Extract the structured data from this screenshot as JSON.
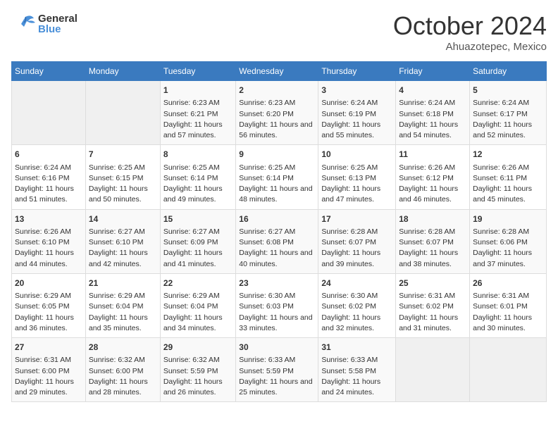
{
  "header": {
    "logo_line1": "General",
    "logo_line2": "Blue",
    "month": "October 2024",
    "location": "Ahuazotepec, Mexico"
  },
  "weekdays": [
    "Sunday",
    "Monday",
    "Tuesday",
    "Wednesday",
    "Thursday",
    "Friday",
    "Saturday"
  ],
  "weeks": [
    [
      {
        "day": "",
        "content": ""
      },
      {
        "day": "",
        "content": ""
      },
      {
        "day": "1",
        "content": "Sunrise: 6:23 AM\nSunset: 6:21 PM\nDaylight: 11 hours and 57 minutes."
      },
      {
        "day": "2",
        "content": "Sunrise: 6:23 AM\nSunset: 6:20 PM\nDaylight: 11 hours and 56 minutes."
      },
      {
        "day": "3",
        "content": "Sunrise: 6:24 AM\nSunset: 6:19 PM\nDaylight: 11 hours and 55 minutes."
      },
      {
        "day": "4",
        "content": "Sunrise: 6:24 AM\nSunset: 6:18 PM\nDaylight: 11 hours and 54 minutes."
      },
      {
        "day": "5",
        "content": "Sunrise: 6:24 AM\nSunset: 6:17 PM\nDaylight: 11 hours and 52 minutes."
      }
    ],
    [
      {
        "day": "6",
        "content": "Sunrise: 6:24 AM\nSunset: 6:16 PM\nDaylight: 11 hours and 51 minutes."
      },
      {
        "day": "7",
        "content": "Sunrise: 6:25 AM\nSunset: 6:15 PM\nDaylight: 11 hours and 50 minutes."
      },
      {
        "day": "8",
        "content": "Sunrise: 6:25 AM\nSunset: 6:14 PM\nDaylight: 11 hours and 49 minutes."
      },
      {
        "day": "9",
        "content": "Sunrise: 6:25 AM\nSunset: 6:14 PM\nDaylight: 11 hours and 48 minutes."
      },
      {
        "day": "10",
        "content": "Sunrise: 6:25 AM\nSunset: 6:13 PM\nDaylight: 11 hours and 47 minutes."
      },
      {
        "day": "11",
        "content": "Sunrise: 6:26 AM\nSunset: 6:12 PM\nDaylight: 11 hours and 46 minutes."
      },
      {
        "day": "12",
        "content": "Sunrise: 6:26 AM\nSunset: 6:11 PM\nDaylight: 11 hours and 45 minutes."
      }
    ],
    [
      {
        "day": "13",
        "content": "Sunrise: 6:26 AM\nSunset: 6:10 PM\nDaylight: 11 hours and 44 minutes."
      },
      {
        "day": "14",
        "content": "Sunrise: 6:27 AM\nSunset: 6:10 PM\nDaylight: 11 hours and 42 minutes."
      },
      {
        "day": "15",
        "content": "Sunrise: 6:27 AM\nSunset: 6:09 PM\nDaylight: 11 hours and 41 minutes."
      },
      {
        "day": "16",
        "content": "Sunrise: 6:27 AM\nSunset: 6:08 PM\nDaylight: 11 hours and 40 minutes."
      },
      {
        "day": "17",
        "content": "Sunrise: 6:28 AM\nSunset: 6:07 PM\nDaylight: 11 hours and 39 minutes."
      },
      {
        "day": "18",
        "content": "Sunrise: 6:28 AM\nSunset: 6:07 PM\nDaylight: 11 hours and 38 minutes."
      },
      {
        "day": "19",
        "content": "Sunrise: 6:28 AM\nSunset: 6:06 PM\nDaylight: 11 hours and 37 minutes."
      }
    ],
    [
      {
        "day": "20",
        "content": "Sunrise: 6:29 AM\nSunset: 6:05 PM\nDaylight: 11 hours and 36 minutes."
      },
      {
        "day": "21",
        "content": "Sunrise: 6:29 AM\nSunset: 6:04 PM\nDaylight: 11 hours and 35 minutes."
      },
      {
        "day": "22",
        "content": "Sunrise: 6:29 AM\nSunset: 6:04 PM\nDaylight: 11 hours and 34 minutes."
      },
      {
        "day": "23",
        "content": "Sunrise: 6:30 AM\nSunset: 6:03 PM\nDaylight: 11 hours and 33 minutes."
      },
      {
        "day": "24",
        "content": "Sunrise: 6:30 AM\nSunset: 6:02 PM\nDaylight: 11 hours and 32 minutes."
      },
      {
        "day": "25",
        "content": "Sunrise: 6:31 AM\nSunset: 6:02 PM\nDaylight: 11 hours and 31 minutes."
      },
      {
        "day": "26",
        "content": "Sunrise: 6:31 AM\nSunset: 6:01 PM\nDaylight: 11 hours and 30 minutes."
      }
    ],
    [
      {
        "day": "27",
        "content": "Sunrise: 6:31 AM\nSunset: 6:00 PM\nDaylight: 11 hours and 29 minutes."
      },
      {
        "day": "28",
        "content": "Sunrise: 6:32 AM\nSunset: 6:00 PM\nDaylight: 11 hours and 28 minutes."
      },
      {
        "day": "29",
        "content": "Sunrise: 6:32 AM\nSunset: 5:59 PM\nDaylight: 11 hours and 26 minutes."
      },
      {
        "day": "30",
        "content": "Sunrise: 6:33 AM\nSunset: 5:59 PM\nDaylight: 11 hours and 25 minutes."
      },
      {
        "day": "31",
        "content": "Sunrise: 6:33 AM\nSunset: 5:58 PM\nDaylight: 11 hours and 24 minutes."
      },
      {
        "day": "",
        "content": ""
      },
      {
        "day": "",
        "content": ""
      }
    ]
  ]
}
